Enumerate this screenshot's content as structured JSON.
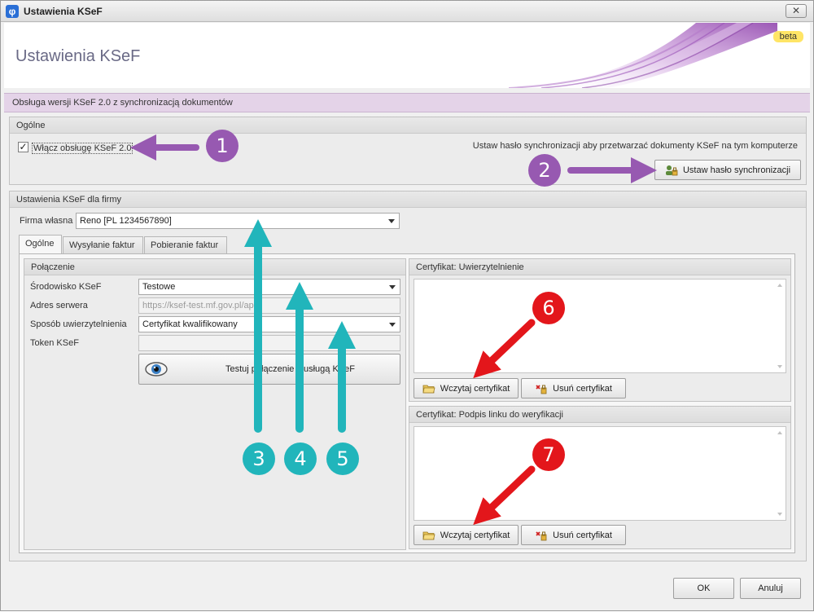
{
  "window": {
    "title": "Ustawienia KSeF",
    "close_glyph": "✕",
    "app_icon_glyph": "φ"
  },
  "header": {
    "title": "Ustawienia KSeF",
    "badge": "beta"
  },
  "info_bar": {
    "text": "Obsługa wersji KSeF 2.0 z synchronizacją dokumentów"
  },
  "general": {
    "header": "Ogólne",
    "enable_label": "Włącz obsługę KSeF 2.0",
    "enable_checked": true,
    "checkmark": "✓",
    "sync_hint": "Ustaw hasło synchronizacji aby przetwarzać dokumenty KSeF na tym komputerze",
    "sync_button": "Ustaw hasło synchronizacji"
  },
  "company": {
    "header": "Ustawienia KSeF dla firmy",
    "own_company_label": "Firma własna",
    "own_company_value": "Reno  [PL 1234567890]",
    "tabs": [
      {
        "label": "Ogólne",
        "active": true
      },
      {
        "label": "Wysyłanie faktur",
        "active": false
      },
      {
        "label": "Pobieranie faktur",
        "active": false
      }
    ],
    "connection": {
      "header": "Połączenie",
      "environment_label": "Środowisko KSeF",
      "environment_value": "Testowe",
      "server_label": "Adres serwera",
      "server_value": "https://ksef-test.mf.gov.pl/api",
      "auth_label": "Sposób uwierzytelnienia",
      "auth_value": "Certyfikat kwalifikowany",
      "token_label": "Token KSeF",
      "token_value": "",
      "test_button": "Testuj połączenie z usługą KSeF"
    },
    "cert_auth": {
      "header": "Certyfikat: Uwierzytelnienie",
      "load_button": "Wczytaj certyfikat",
      "remove_button": "Usuń certyfikat"
    },
    "cert_sign": {
      "header": "Certyfikat: Podpis linku do weryfikacji",
      "load_button": "Wczytaj certyfikat",
      "remove_button": "Usuń certyfikat"
    }
  },
  "footer": {
    "ok_button": "OK",
    "cancel_button": "Anuluj"
  },
  "callouts": [
    "1",
    "2",
    "3",
    "4",
    "5",
    "6",
    "7"
  ],
  "colors": {
    "callout_purple": "#9759b1",
    "callout_teal": "#21b5bb",
    "callout_red": "#e3161b",
    "info_bar": "#e4d3e8",
    "badge": "#ffe566"
  }
}
